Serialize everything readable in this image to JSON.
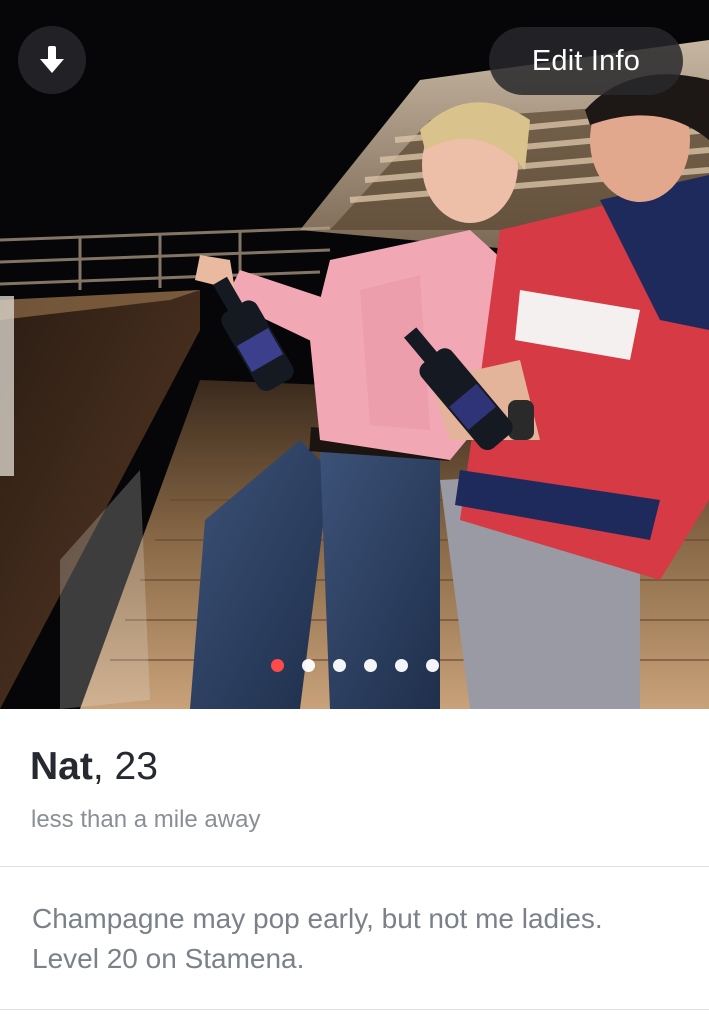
{
  "header": {
    "edit_label": "Edit Info",
    "down_icon": "arrow-down-icon"
  },
  "carousel": {
    "photo_count": 6,
    "active_index": 0,
    "active_color": "#ff4a4a",
    "inactive_color": "#ffffff"
  },
  "profile": {
    "name": "Nat",
    "separator": ",",
    "age": "23",
    "distance": "less than a mile away",
    "bio_lines": [
      "Champagne may pop early, but not me ladies.",
      "Level 20 on Stamena."
    ]
  },
  "colors": {
    "name_text": "#262a30",
    "secondary_text": "#8a8f96",
    "bio_text": "#7b8189",
    "button_bg": "#28282c"
  }
}
